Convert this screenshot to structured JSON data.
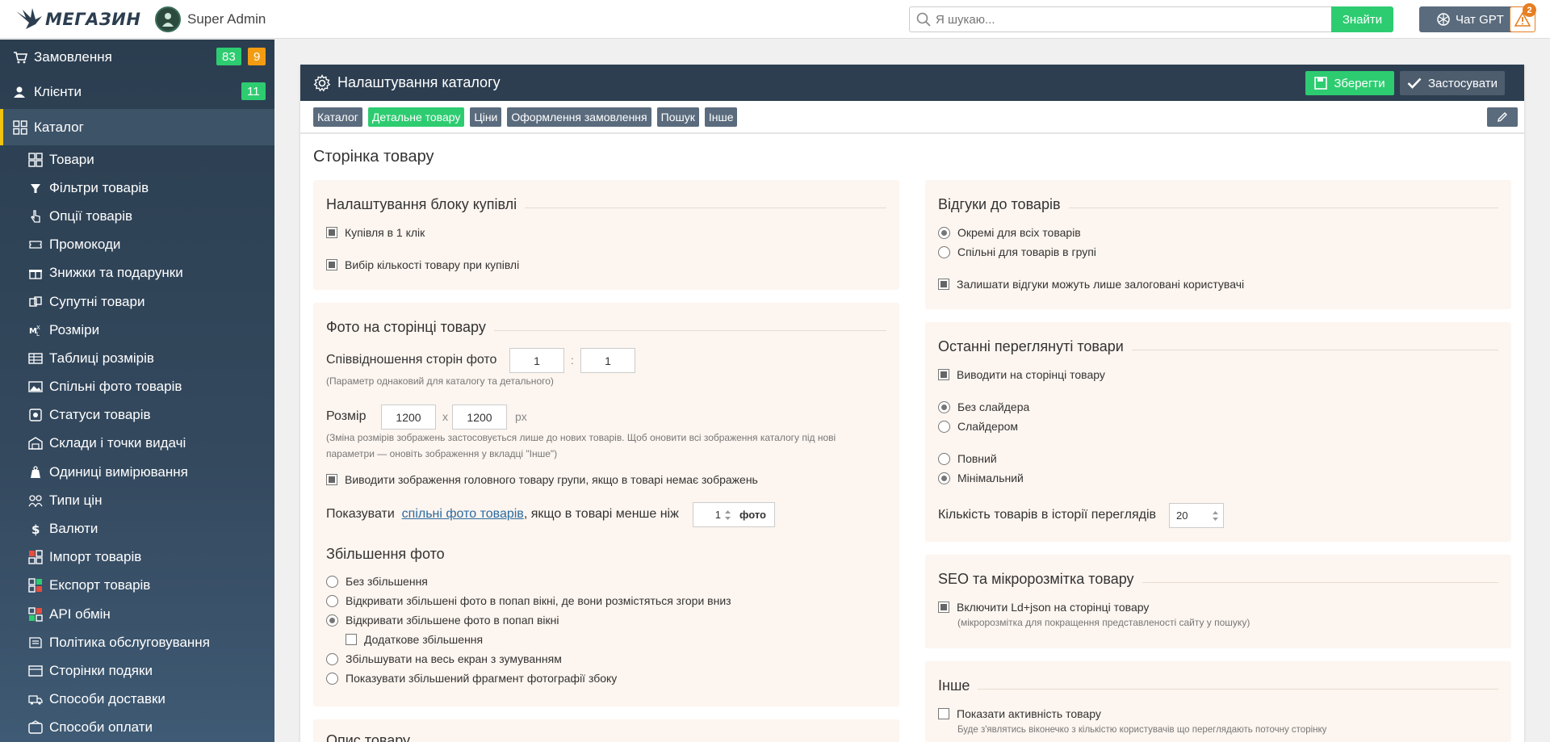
{
  "topbar": {
    "logo_text": "МЕГАЗИН",
    "user_name": "Super Admin",
    "search_placeholder": "Я шукаю...",
    "search_button": "Знайти",
    "gpt_label": "Чат GPT",
    "alert_count": "2"
  },
  "sidebar": {
    "orders_label": "Замовлення",
    "orders_badge_green": "83",
    "orders_badge_orange": "9",
    "clients_label": "Клієнти",
    "clients_badge": "11",
    "catalog_label": "Каталог",
    "items": [
      {
        "label": "Товари",
        "icon": "grid-icon"
      },
      {
        "label": "Фільтри товарів",
        "icon": "filter-icon"
      },
      {
        "label": "Опції товарів",
        "icon": "pointer-icon"
      },
      {
        "label": "Промокоди",
        "icon": "ticket-icon"
      },
      {
        "label": "Знижки та подарунки",
        "icon": "gift-icon"
      },
      {
        "label": "Супутні товари",
        "icon": "related-icon"
      },
      {
        "label": "Розміри",
        "icon": "sizes-icon"
      },
      {
        "label": "Таблиці розмірів",
        "icon": "table-icon"
      },
      {
        "label": "Спільні фото товарів",
        "icon": "image-icon"
      },
      {
        "label": "Статуси товарів",
        "icon": "status-icon"
      },
      {
        "label": "Склади і точки видачі",
        "icon": "warehouse-icon"
      },
      {
        "label": "Одиниці вимірювання",
        "icon": "weight-icon"
      },
      {
        "label": "Типи цін",
        "icon": "price-type-icon"
      },
      {
        "label": "Валюти",
        "icon": "dollar-icon"
      },
      {
        "label": "Імпорт товарів",
        "icon": "import-icon"
      },
      {
        "label": "Експорт товарів",
        "icon": "export-icon"
      },
      {
        "label": "API обмін",
        "icon": "api-icon"
      },
      {
        "label": "Політика обслуговування",
        "icon": "policy-icon"
      },
      {
        "label": "Сторінки подяки",
        "icon": "thanks-icon"
      },
      {
        "label": "Способи доставки",
        "icon": "delivery-icon"
      },
      {
        "label": "Способи оплати",
        "icon": "payment-icon"
      }
    ]
  },
  "panel": {
    "title": "Налаштування каталогу",
    "save_button": "Зберегти",
    "apply_button": "Застосувати",
    "tabs": [
      "Каталог",
      "Детальне товару",
      "Ціни",
      "Оформлення замовлення",
      "Пошук",
      "Інше"
    ],
    "active_tab": "Детальне товару",
    "page_title": "Сторінка товару"
  },
  "buy_block": {
    "heading": "Налаштування блоку купівлі",
    "one_click": "Купівля в 1 клік",
    "qty_select": "Вибір кількості товару при купівлі"
  },
  "photo": {
    "heading": "Фото на сторінці товару",
    "ratio_label": "Співвідношення сторін фото",
    "ratio_w": "1",
    "ratio_colon": ":",
    "ratio_h": "1",
    "ratio_note": "(Параметр однаковий для каталогу та детального)",
    "size_label": "Розмір",
    "size_w": "1200",
    "size_x": "x",
    "size_h": "1200",
    "size_unit": "px",
    "size_note_1": "(Зміна розмірів зображень застосовується лише до нових товарів. Щоб оновити всі зображення каталогу під нові",
    "size_note_2": "параметри — оновіть зображення у вкладці \"Інше\")",
    "group_main": "Виводити зображення головного товару групи, якщо в товарі немає зображень",
    "show_prefix": "Показувати",
    "show_link": "спільні фото товарів",
    "show_suffix": ", якщо в товарі менше ніж",
    "show_count": "1",
    "show_unit": "фото",
    "zoom_heading": "Збільшення фото",
    "zoom_none": "Без збільшення",
    "zoom_popup_scroll": "Відкривати збільшені фото в попап вікні, де вони розмістяться згори вниз",
    "zoom_popup": "Відкривати збільшене фото в попап вікні",
    "zoom_extra": "Додаткове збільшення",
    "zoom_fullscreen": "Збільшувати на весь екран з зумуванням",
    "zoom_fragment": "Показувати збільшений фрагмент фотографії збоку"
  },
  "description": {
    "heading": "Опис товару"
  },
  "reviews": {
    "heading": "Відгуки до товарів",
    "separate": "Окремі для всіх товарів",
    "shared": "Спільні для товарів в групі",
    "logged_only": "Залишати відгуки можуть лише залоговані користувачі"
  },
  "recent": {
    "heading": "Останні переглянуті товари",
    "show_on_page": "Виводити на сторінці товару",
    "no_slider": "Без слайдера",
    "slider": "Слайдером",
    "full": "Повний",
    "minimal": "Мінімальний",
    "history_label": "Кількість товарів в історії переглядів",
    "history_count": "20"
  },
  "seo": {
    "heading": "SEO та мікророзмітка товару",
    "ldjson": "Включити Ld+json на сторінці товару",
    "ldjson_note": "(мікророзмітка для покращення представленості сайту у пошуку)"
  },
  "other": {
    "heading": "Інше",
    "activity": "Показати активність товару",
    "activity_note": "Буде з'являтись віконечко з кількістю користувачів що переглядають поточну сторінку"
  },
  "colors": {
    "accent_green": "#2ecc71",
    "header_dark": "#2c3e50",
    "badge_orange": "#f39c12",
    "card_bg": "#fdf5ef"
  }
}
